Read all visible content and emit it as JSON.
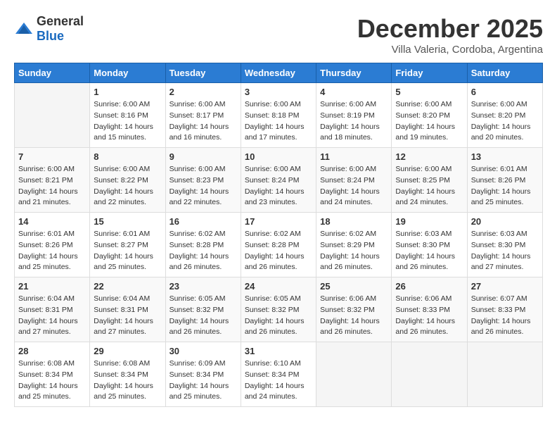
{
  "header": {
    "logo_general": "General",
    "logo_blue": "Blue",
    "month": "December 2025",
    "location": "Villa Valeria, Cordoba, Argentina"
  },
  "weekdays": [
    "Sunday",
    "Monday",
    "Tuesday",
    "Wednesday",
    "Thursday",
    "Friday",
    "Saturday"
  ],
  "weeks": [
    [
      {
        "day": "",
        "sunrise": "",
        "sunset": "",
        "daylight": ""
      },
      {
        "day": "1",
        "sunrise": "Sunrise: 6:00 AM",
        "sunset": "Sunset: 8:16 PM",
        "daylight": "Daylight: 14 hours and 15 minutes."
      },
      {
        "day": "2",
        "sunrise": "Sunrise: 6:00 AM",
        "sunset": "Sunset: 8:17 PM",
        "daylight": "Daylight: 14 hours and 16 minutes."
      },
      {
        "day": "3",
        "sunrise": "Sunrise: 6:00 AM",
        "sunset": "Sunset: 8:18 PM",
        "daylight": "Daylight: 14 hours and 17 minutes."
      },
      {
        "day": "4",
        "sunrise": "Sunrise: 6:00 AM",
        "sunset": "Sunset: 8:19 PM",
        "daylight": "Daylight: 14 hours and 18 minutes."
      },
      {
        "day": "5",
        "sunrise": "Sunrise: 6:00 AM",
        "sunset": "Sunset: 8:20 PM",
        "daylight": "Daylight: 14 hours and 19 minutes."
      },
      {
        "day": "6",
        "sunrise": "Sunrise: 6:00 AM",
        "sunset": "Sunset: 8:20 PM",
        "daylight": "Daylight: 14 hours and 20 minutes."
      }
    ],
    [
      {
        "day": "7",
        "sunrise": "Sunrise: 6:00 AM",
        "sunset": "Sunset: 8:21 PM",
        "daylight": "Daylight: 14 hours and 21 minutes."
      },
      {
        "day": "8",
        "sunrise": "Sunrise: 6:00 AM",
        "sunset": "Sunset: 8:22 PM",
        "daylight": "Daylight: 14 hours and 22 minutes."
      },
      {
        "day": "9",
        "sunrise": "Sunrise: 6:00 AM",
        "sunset": "Sunset: 8:23 PM",
        "daylight": "Daylight: 14 hours and 22 minutes."
      },
      {
        "day": "10",
        "sunrise": "Sunrise: 6:00 AM",
        "sunset": "Sunset: 8:24 PM",
        "daylight": "Daylight: 14 hours and 23 minutes."
      },
      {
        "day": "11",
        "sunrise": "Sunrise: 6:00 AM",
        "sunset": "Sunset: 8:24 PM",
        "daylight": "Daylight: 14 hours and 24 minutes."
      },
      {
        "day": "12",
        "sunrise": "Sunrise: 6:00 AM",
        "sunset": "Sunset: 8:25 PM",
        "daylight": "Daylight: 14 hours and 24 minutes."
      },
      {
        "day": "13",
        "sunrise": "Sunrise: 6:01 AM",
        "sunset": "Sunset: 8:26 PM",
        "daylight": "Daylight: 14 hours and 25 minutes."
      }
    ],
    [
      {
        "day": "14",
        "sunrise": "Sunrise: 6:01 AM",
        "sunset": "Sunset: 8:26 PM",
        "daylight": "Daylight: 14 hours and 25 minutes."
      },
      {
        "day": "15",
        "sunrise": "Sunrise: 6:01 AM",
        "sunset": "Sunset: 8:27 PM",
        "daylight": "Daylight: 14 hours and 25 minutes."
      },
      {
        "day": "16",
        "sunrise": "Sunrise: 6:02 AM",
        "sunset": "Sunset: 8:28 PM",
        "daylight": "Daylight: 14 hours and 26 minutes."
      },
      {
        "day": "17",
        "sunrise": "Sunrise: 6:02 AM",
        "sunset": "Sunset: 8:28 PM",
        "daylight": "Daylight: 14 hours and 26 minutes."
      },
      {
        "day": "18",
        "sunrise": "Sunrise: 6:02 AM",
        "sunset": "Sunset: 8:29 PM",
        "daylight": "Daylight: 14 hours and 26 minutes."
      },
      {
        "day": "19",
        "sunrise": "Sunrise: 6:03 AM",
        "sunset": "Sunset: 8:30 PM",
        "daylight": "Daylight: 14 hours and 26 minutes."
      },
      {
        "day": "20",
        "sunrise": "Sunrise: 6:03 AM",
        "sunset": "Sunset: 8:30 PM",
        "daylight": "Daylight: 14 hours and 27 minutes."
      }
    ],
    [
      {
        "day": "21",
        "sunrise": "Sunrise: 6:04 AM",
        "sunset": "Sunset: 8:31 PM",
        "daylight": "Daylight: 14 hours and 27 minutes."
      },
      {
        "day": "22",
        "sunrise": "Sunrise: 6:04 AM",
        "sunset": "Sunset: 8:31 PM",
        "daylight": "Daylight: 14 hours and 27 minutes."
      },
      {
        "day": "23",
        "sunrise": "Sunrise: 6:05 AM",
        "sunset": "Sunset: 8:32 PM",
        "daylight": "Daylight: 14 hours and 26 minutes."
      },
      {
        "day": "24",
        "sunrise": "Sunrise: 6:05 AM",
        "sunset": "Sunset: 8:32 PM",
        "daylight": "Daylight: 14 hours and 26 minutes."
      },
      {
        "day": "25",
        "sunrise": "Sunrise: 6:06 AM",
        "sunset": "Sunset: 8:32 PM",
        "daylight": "Daylight: 14 hours and 26 minutes."
      },
      {
        "day": "26",
        "sunrise": "Sunrise: 6:06 AM",
        "sunset": "Sunset: 8:33 PM",
        "daylight": "Daylight: 14 hours and 26 minutes."
      },
      {
        "day": "27",
        "sunrise": "Sunrise: 6:07 AM",
        "sunset": "Sunset: 8:33 PM",
        "daylight": "Daylight: 14 hours and 26 minutes."
      }
    ],
    [
      {
        "day": "28",
        "sunrise": "Sunrise: 6:08 AM",
        "sunset": "Sunset: 8:34 PM",
        "daylight": "Daylight: 14 hours and 25 minutes."
      },
      {
        "day": "29",
        "sunrise": "Sunrise: 6:08 AM",
        "sunset": "Sunset: 8:34 PM",
        "daylight": "Daylight: 14 hours and 25 minutes."
      },
      {
        "day": "30",
        "sunrise": "Sunrise: 6:09 AM",
        "sunset": "Sunset: 8:34 PM",
        "daylight": "Daylight: 14 hours and 25 minutes."
      },
      {
        "day": "31",
        "sunrise": "Sunrise: 6:10 AM",
        "sunset": "Sunset: 8:34 PM",
        "daylight": "Daylight: 14 hours and 24 minutes."
      },
      {
        "day": "",
        "sunrise": "",
        "sunset": "",
        "daylight": ""
      },
      {
        "day": "",
        "sunrise": "",
        "sunset": "",
        "daylight": ""
      },
      {
        "day": "",
        "sunrise": "",
        "sunset": "",
        "daylight": ""
      }
    ]
  ]
}
